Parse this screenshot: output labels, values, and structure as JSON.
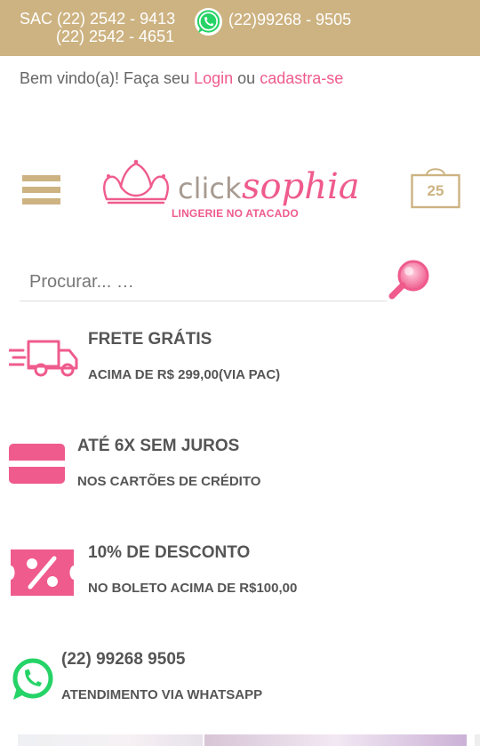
{
  "topbar": {
    "sac_label": "SAC",
    "phone1": "(22) 2542 - 9413",
    "phone2": "(22) 2542 - 4651",
    "whatsapp": "(22)99268 - 9505",
    "bg_color": "#cdb382"
  },
  "welcome": {
    "text": "Bem vindo(a)! Faça seu",
    "login": "Login",
    "or": "ou",
    "register": "cadastra-se",
    "link_color": "#ef5b8c"
  },
  "header": {
    "logo_word1": "click",
    "logo_word2": "sophia",
    "logo_tagline": "LINGERIE NO ATACADO",
    "cart_count": "25",
    "menu_icon": "hamburger-icon",
    "cart_icon": "shopping-bag-icon"
  },
  "search": {
    "placeholder": "Procurar... …",
    "icon": "search-icon"
  },
  "features": [
    {
      "icon": "delivery-truck-icon",
      "title": "FRETE GRÁTIS",
      "subtitle": "ACIMA DE R$ 299,00(VIA PAC)"
    },
    {
      "icon": "credit-card-icon",
      "title": "ATÉ 6X SEM JUROS",
      "subtitle": "NOS CARTÕES DE CRÉDITO"
    },
    {
      "icon": "discount-ticket-icon",
      "title": "10% DE DESCONTO",
      "subtitle": "NO BOLETO ACIMA DE R$100,00"
    },
    {
      "icon": "whatsapp-icon",
      "title": "(22) 99268 9505",
      "subtitle": "ATENDIMENTO VIA WHATSAPP"
    }
  ],
  "colors": {
    "accent_pink": "#ef5b8c",
    "gold": "#cdb382",
    "whatsapp_green": "#25d366"
  }
}
